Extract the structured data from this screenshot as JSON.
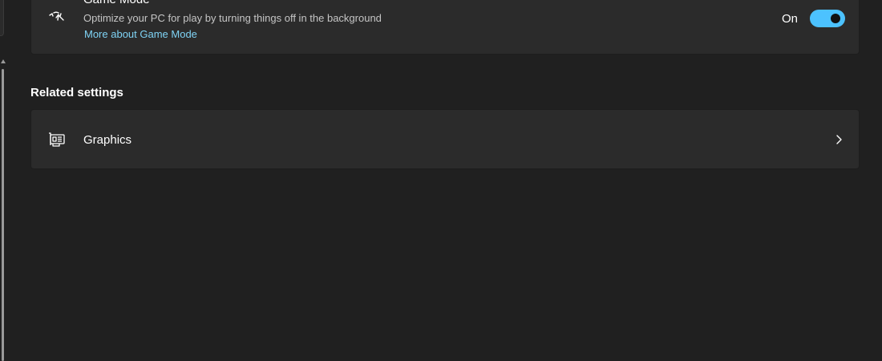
{
  "game_mode": {
    "title": "Game Mode",
    "description": "Optimize your PC for play by turning things off in the background",
    "link": "More about Game Mode",
    "toggle_state": "On",
    "enabled": true,
    "icon": "game-mode-gauge-icon"
  },
  "related_settings": {
    "heading": "Related settings",
    "items": [
      {
        "label": "Graphics",
        "icon": "graphics-card-icon"
      }
    ]
  },
  "colors": {
    "accent": "#4cc2ff",
    "link": "#7fd3f5",
    "background": "#202020",
    "card": "#2b2b2b"
  }
}
